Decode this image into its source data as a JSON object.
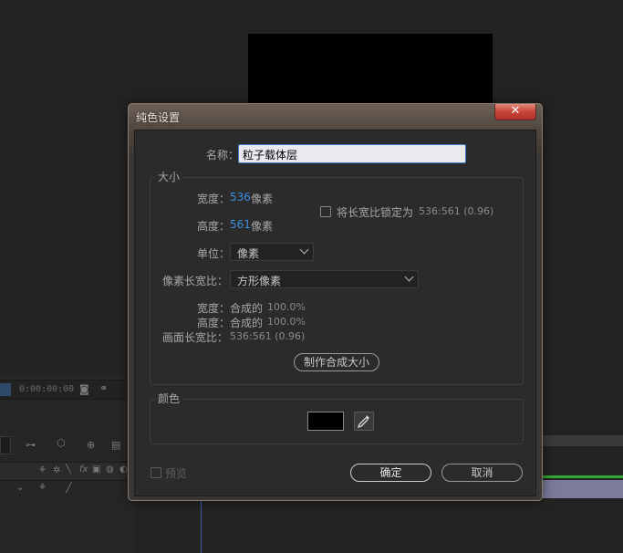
{
  "background": {
    "timecode": "0:00:00:00"
  },
  "dialog": {
    "title": "纯色设置",
    "close_glyph": "✕",
    "name_label": "名称：",
    "name_value": "粒子载体层",
    "size_group": {
      "title": "大小",
      "width_label": "宽度：",
      "width_value": "536",
      "height_label": "高度：",
      "height_value": "561",
      "unit_pixels": "像素",
      "lock_label": "将长宽比锁定为",
      "lock_ratio": "536:561 (0.96)",
      "units_label": "单位：",
      "units_value": "像素",
      "pixel_aspect_label": "像素长宽比：",
      "pixel_aspect_value": "方形像素",
      "info_width_label": "宽度：",
      "info_width_value": "合成的",
      "info_width_pct": "100.0%",
      "info_height_label": "高度：",
      "info_height_value": "合成的",
      "info_height_pct": "100.0%",
      "frame_aspect_label": "画面长宽比：",
      "frame_aspect_value": "536:561 (0.96)",
      "make_comp_size": "制作合成大小"
    },
    "color_group": {
      "title": "颜色",
      "swatch_color": "#000000"
    },
    "preview_label": "预览",
    "ok_label": "确定",
    "cancel_label": "取消"
  }
}
